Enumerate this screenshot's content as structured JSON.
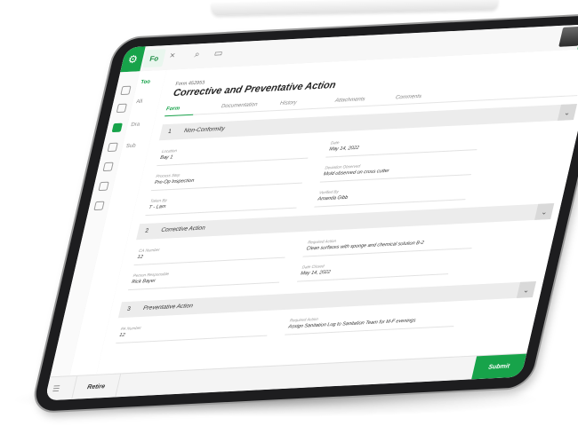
{
  "topbar": {
    "app_tab_label": "Fo",
    "close_symbol": "×",
    "attach_symbol": "⌕",
    "comment_symbol": "▭",
    "notification_count": "1"
  },
  "subnav": {
    "items": [
      "Too",
      "All",
      "Dra",
      "Sub"
    ]
  },
  "form": {
    "id": "Form 452953",
    "title": "Corrective and Preventative Action"
  },
  "tabs": [
    {
      "label": "Form",
      "active": true
    },
    {
      "label": "Documentation",
      "active": false
    },
    {
      "label": "History",
      "active": false
    },
    {
      "label": "Attachments",
      "active": false
    },
    {
      "label": "Comments",
      "active": false
    }
  ],
  "sections": [
    {
      "number": "1",
      "title": "Non-Conformity",
      "fields": [
        {
          "label": "Location",
          "value": "Bay 1"
        },
        {
          "label": "Date",
          "value": "May 14, 2022"
        },
        {
          "label": "Process Step",
          "value": "Pre-Op Inspection"
        },
        {
          "label": "Deviation Observed",
          "value": "Mold observed on cross cutter"
        },
        {
          "label": "Taken By",
          "value": "T - Lam"
        },
        {
          "label": "Verified By",
          "value": "Amanda Gibb"
        }
      ]
    },
    {
      "number": "2",
      "title": "Corrective Action",
      "fields": [
        {
          "label": "CA Number",
          "value": "12"
        },
        {
          "label": "Required Action",
          "value": "Clean surfaces with sponge and chemical solution B-2"
        },
        {
          "label": "Person Responsible",
          "value": "Rick Bayer"
        },
        {
          "label": "Date Closed",
          "value": "May 14, 2022"
        }
      ]
    },
    {
      "number": "3",
      "title": "Preventative Action",
      "fields": [
        {
          "label": "PA Number",
          "value": "12"
        },
        {
          "label": "Required Action",
          "value": "Assign Sanitation Log to Sanitation Team for M-F evenings"
        }
      ]
    }
  ],
  "footer": {
    "retire_label": "Retire",
    "submit_label": "Submit"
  },
  "colors": {
    "accent": "#17a34a",
    "section_bg": "#ececec",
    "bezel": "#1d1d1f"
  }
}
